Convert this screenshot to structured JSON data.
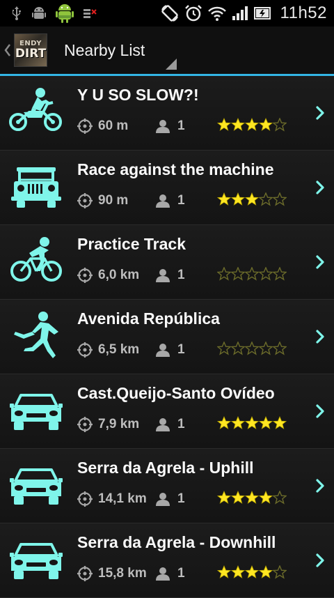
{
  "statusbar": {
    "time": "11h52"
  },
  "actionbar": {
    "logo_top": "ENDY",
    "logo_bottom": "DIRT",
    "title": "Nearby List"
  },
  "colors": {
    "accent": "#33b5e5",
    "vehicle_icon": "#7ff5ea",
    "star_filled": "#ffe622",
    "star_empty_stroke": "#6b6b2a",
    "chevron": "#7ff5ea"
  },
  "tracks": [
    {
      "title": "Y U SO SLOW?!",
      "vehicle": "motorcycle-icon",
      "distance": "60 m",
      "users": "1",
      "rating": 4
    },
    {
      "title": "Race against the machine",
      "vehicle": "jeep-icon",
      "distance": "90 m",
      "users": "1",
      "rating": 3
    },
    {
      "title": "Practice Track",
      "vehicle": "bicycle-icon",
      "distance": "6,0 km",
      "users": "1",
      "rating": 0
    },
    {
      "title": "Avenida República",
      "vehicle": "runner-icon",
      "distance": "6,5 km",
      "users": "1",
      "rating": 0
    },
    {
      "title": "Cast.Queijo-Santo Ovídeo",
      "vehicle": "car-icon",
      "distance": "7,9 km",
      "users": "1",
      "rating": 5
    },
    {
      "title": "Serra da Agrela - Uphill",
      "vehicle": "car-icon",
      "distance": "14,1 km",
      "users": "1",
      "rating": 4
    },
    {
      "title": "Serra da Agrela - Downhill",
      "vehicle": "car-icon",
      "distance": "15,8 km",
      "users": "1",
      "rating": 4
    }
  ]
}
